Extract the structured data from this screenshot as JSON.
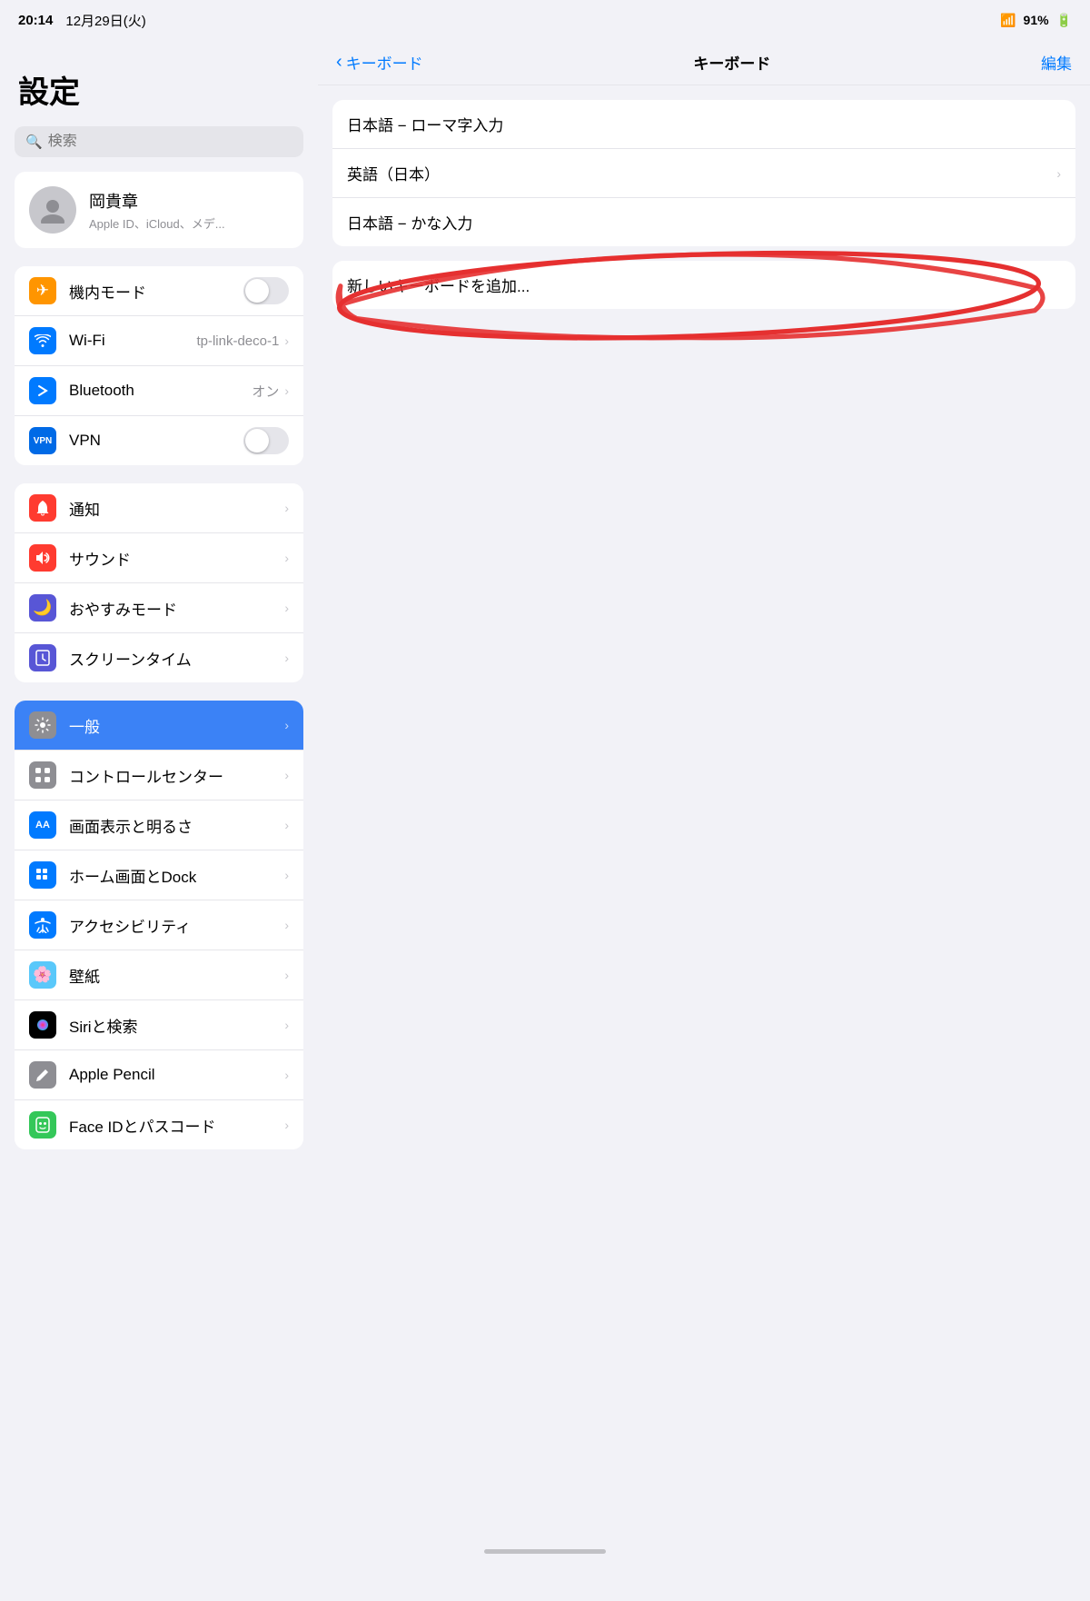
{
  "status_bar": {
    "time": "20:14",
    "date": "12月29日(火)",
    "wifi_percent": "91%"
  },
  "sidebar": {
    "title": "設定",
    "search_placeholder": "検索",
    "profile": {
      "name": "岡貴章",
      "sub": "Apple ID、iCloud、メデ..."
    },
    "group1": [
      {
        "id": "airplane",
        "label": "機内モード",
        "icon_bg": "#ff9500",
        "icon": "✈",
        "control": "toggle",
        "toggle_on": false
      },
      {
        "id": "wifi",
        "label": "Wi-Fi",
        "icon_bg": "#007aff",
        "icon": "📶",
        "control": "text",
        "value": "tp-link-deco-1"
      },
      {
        "id": "bluetooth",
        "label": "Bluetooth",
        "icon_bg": "#007aff",
        "icon": "🔷",
        "control": "text",
        "value": "オン"
      },
      {
        "id": "vpn",
        "label": "VPN",
        "icon_bg": "#006ae6",
        "icon": "VPN",
        "control": "toggle",
        "toggle_on": false
      }
    ],
    "group2": [
      {
        "id": "notification",
        "label": "通知",
        "icon_bg": "#ff3b30",
        "icon": "🔔"
      },
      {
        "id": "sound",
        "label": "サウンド",
        "icon_bg": "#ff3b30",
        "icon": "🔊"
      },
      {
        "id": "donotdisturb",
        "label": "おやすみモード",
        "icon_bg": "#5856d6",
        "icon": "🌙"
      },
      {
        "id": "screentime",
        "label": "スクリーンタイム",
        "icon_bg": "#5856d6",
        "icon": "⏳"
      }
    ],
    "group3": [
      {
        "id": "general",
        "label": "一般",
        "icon_bg": "#8e8e93",
        "icon": "⚙",
        "active": true
      },
      {
        "id": "controlcenter",
        "label": "コントロールセンター",
        "icon_bg": "#8e8e93",
        "icon": "🎛"
      },
      {
        "id": "display",
        "label": "画面表示と明るさ",
        "icon_bg": "#007aff",
        "icon": "AA"
      },
      {
        "id": "homescreen",
        "label": "ホーム画面とDock",
        "icon_bg": "#007aff",
        "icon": "⊞"
      },
      {
        "id": "accessibility",
        "label": "アクセシビリティ",
        "icon_bg": "#007aff",
        "icon": "♿"
      },
      {
        "id": "wallpaper",
        "label": "壁紙",
        "icon_bg": "#5ac8fa",
        "icon": "🌸"
      },
      {
        "id": "siri",
        "label": "Siriと検索",
        "icon_bg": "#000",
        "icon": "◎"
      },
      {
        "id": "applepencil",
        "label": "Apple Pencil",
        "icon_bg": "#8e8e93",
        "icon": "✏"
      },
      {
        "id": "faceid",
        "label": "Face IDとパスコード",
        "icon_bg": "#34c759",
        "icon": "👤"
      }
    ]
  },
  "right_panel": {
    "back_label": "キーボード",
    "title": "キーボード",
    "edit_label": "編集",
    "keyboards": [
      {
        "label": "日本語 − ローマ字入力",
        "has_chevron": false
      },
      {
        "label": "英語（日本）",
        "has_chevron": true
      },
      {
        "label": "日本語 − かな入力",
        "has_chevron": false
      }
    ],
    "add_keyboard_label": "新しいキーボードを追加..."
  }
}
